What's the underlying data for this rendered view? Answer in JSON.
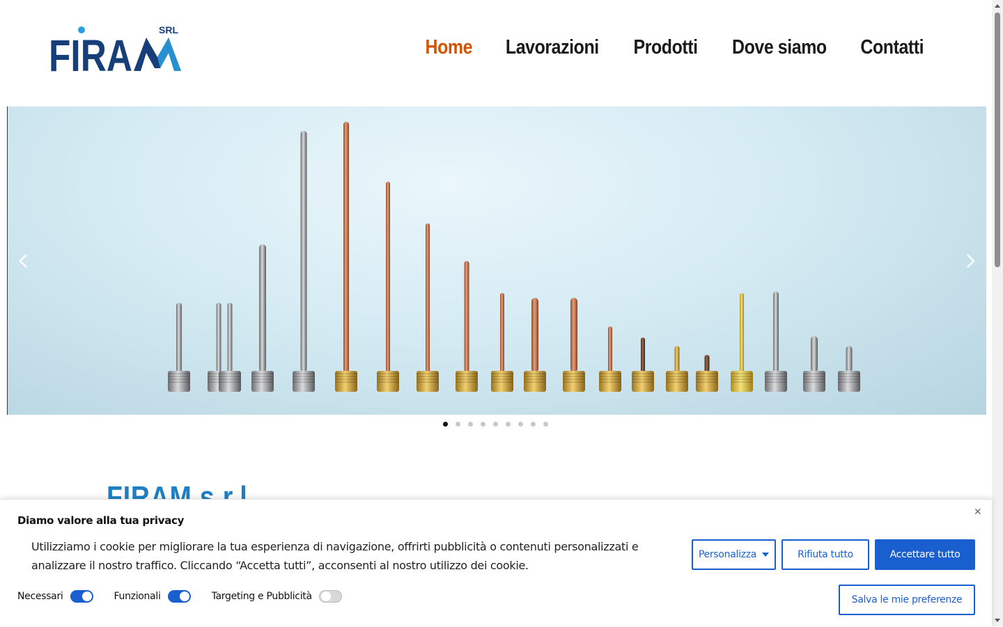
{
  "brand": {
    "name": "FIRAM",
    "suffix": "SRL",
    "logo_color": "#163f7a",
    "accent_color": "#2a9fe0"
  },
  "nav": {
    "items": [
      {
        "label": "Home",
        "active": true
      },
      {
        "label": "Lavorazioni",
        "active": false
      },
      {
        "label": "Prodotti",
        "active": false
      },
      {
        "label": "Dove siamo",
        "active": false
      },
      {
        "label": "Contatti",
        "active": false
      }
    ],
    "active_color": "#d35400"
  },
  "slider": {
    "prev_icon": "chevron-left-icon",
    "next_icon": "chevron-right-icon",
    "slide_count": 9,
    "active_slide": 1
  },
  "section": {
    "title": "FIRAM s.r.l."
  },
  "cookie": {
    "title": "Diamo valore alla tua privacy",
    "close_icon": "close-icon",
    "text": "Utilizziamo i cookie per migliorare la tua esperienza di navigazione, offrirti pubblicità o contenuti personalizzati e analizzare il nostro traffico. Cliccando “Accetta tutti”, acconsenti al nostro utilizzo dei cookie.",
    "toggles": [
      {
        "label": "Necessari",
        "on": true
      },
      {
        "label": "Funzionali",
        "on": true
      },
      {
        "label": "Targeting e Pubblicità",
        "on": false
      }
    ],
    "buttons": {
      "customize": "Personalizza",
      "reject": "Rifiuta tutto",
      "accept": "Accettare tutto",
      "save": "Salva le mie preferenze"
    },
    "button_color": "#1a5fd0"
  }
}
